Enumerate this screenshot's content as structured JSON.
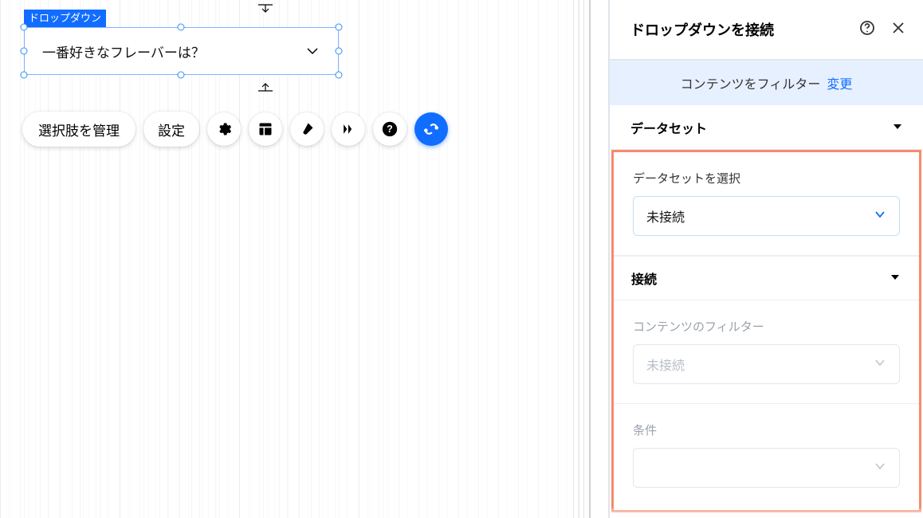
{
  "element": {
    "type_label": "ドロップダウン",
    "placeholder": "一番好きなフレーバーは？"
  },
  "toolbar": {
    "manage_options": "選択肢を管理",
    "settings": "設定"
  },
  "panel": {
    "title": "ドロップダウンを接続",
    "banner_text": "コンテンツをフィルター",
    "banner_link": "変更",
    "section_dataset": "データセット",
    "dataset_select_label": "データセットを選択",
    "dataset_select_value": "未接続",
    "section_connect": "接続",
    "filter_label": "コンテンツのフィルター",
    "filter_value": "未接続",
    "condition_label": "条件",
    "condition_value": ""
  }
}
